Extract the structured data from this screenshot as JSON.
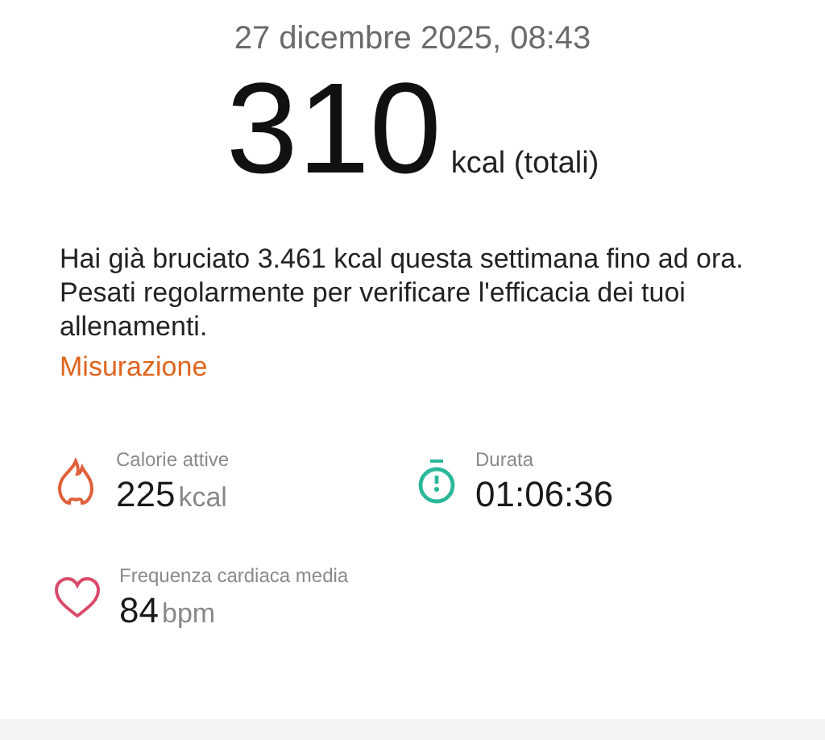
{
  "date": "27 dicembre 2025, 08:43",
  "total": {
    "value": "310",
    "unit": "kcal (totali)"
  },
  "summary": "Hai già bruciato 3.461 kcal questa settimana fino ad ora. Pesati regolarmente per verificare l'efficacia dei tuoi allenamenti.",
  "link": "Misurazione",
  "stats": [
    {
      "kind": "flame",
      "label": "Calorie attive",
      "value": "225",
      "unit": "kcal"
    },
    {
      "kind": "stopwatch",
      "label": "Durata",
      "value": "01:06:36"
    },
    {
      "kind": "heart",
      "label": "Frequenza cardiaca media",
      "value": "84",
      "unit": "bpm"
    }
  ]
}
